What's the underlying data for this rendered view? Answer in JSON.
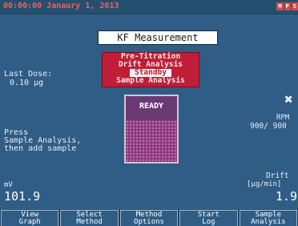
{
  "topbar": {
    "datetime": "00:00:00 Janaury 1, 2013",
    "status_icons": [
      "M",
      "P",
      "S"
    ]
  },
  "title": "KF Measurement",
  "modes": {
    "items": [
      "Pre-Titration",
      "Drift Analysis",
      "Standby",
      "Sample Analysis"
    ],
    "selected_index": 2
  },
  "last_dose": {
    "label": "Last Dose:",
    "value": "0.10 µg"
  },
  "instruction": {
    "line1": "Press",
    "line2": "Sample Analysis,",
    "line3": "then add sample"
  },
  "beaker": {
    "status": "READY"
  },
  "stirrer": {
    "icon": "stirrer-icon",
    "label": "RPM",
    "value": "900/ 900"
  },
  "mv": {
    "label": "mV",
    "value": "101.9"
  },
  "drift": {
    "label": "Drift",
    "unit": "[µg/min]",
    "value": "1.9"
  },
  "softkeys": [
    {
      "line1": "View",
      "line2": "Graph"
    },
    {
      "line1": "Select",
      "line2": "Method"
    },
    {
      "line1": "Method",
      "line2": "Options"
    },
    {
      "line1": "Start",
      "line2": "Log"
    },
    {
      "line1": "Sample",
      "line2": "Analysis"
    }
  ],
  "colors": {
    "background": "#2f5d86",
    "mode_panel": "#c01e36",
    "datetime": "#ff5a5a",
    "liquid": "#8a3c7e"
  }
}
